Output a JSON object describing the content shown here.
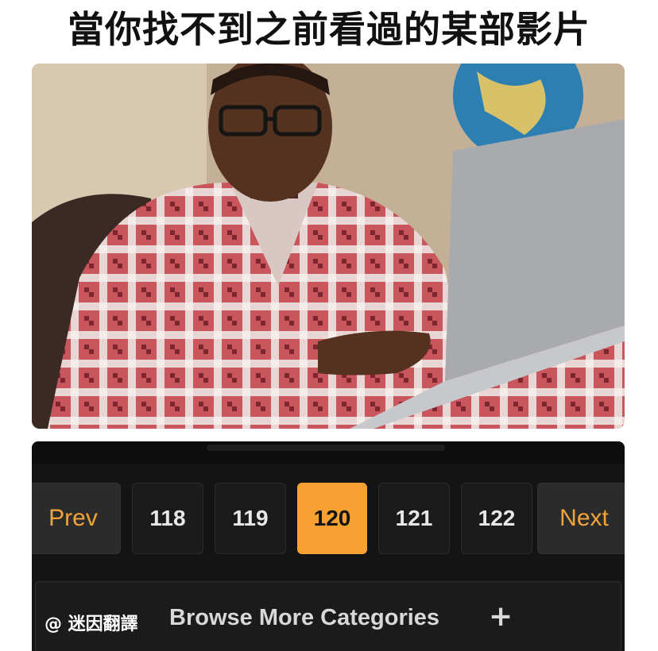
{
  "caption": "當你找不到之前看過的某部影片",
  "pagination": {
    "prev_label": "Prev",
    "next_label": "Next",
    "pages": [
      "118",
      "119",
      "120",
      "121",
      "122"
    ],
    "current": "120"
  },
  "browse": {
    "label": "Browse More Categories",
    "icon": "plus-icon"
  },
  "watermark": "@ 迷因翻譯",
  "colors": {
    "accent": "#f7a133",
    "background": "#141414",
    "button": "#1b1b1b",
    "prev_next_text": "#f2a33a"
  }
}
